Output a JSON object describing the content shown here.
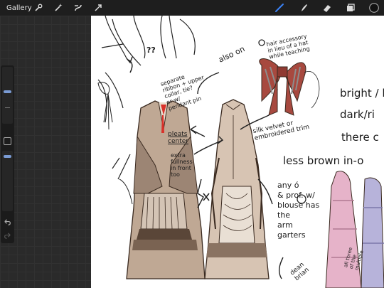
{
  "topbar": {
    "gallery_label": "Gallery",
    "icons": [
      "wrench-icon",
      "magic-wand-icon",
      "selection-icon",
      "transform-icon",
      "brush-icon",
      "smudge-icon",
      "eraser-icon",
      "layers-icon",
      "color-swatch"
    ],
    "active_color": "#111111",
    "accent": "#3b82f6"
  },
  "canvas_notes": {
    "hair_accessory": "hair accessory\nin lieu of a hat\nwhile teaching",
    "also_on": "also on",
    "question_marks": "??",
    "separate_ribbon": "separate\nribbon + upper\ncollar, tie?\nor w/\npendant pin",
    "pleats_center": "pleats\ncenter",
    "extra_fullness": "extra\nfullness\nin front\ntoo",
    "silk_velvet": "silk velvet or\nembroidered trim",
    "bright": "bright / li",
    "dark": "dark/ri",
    "there": "there c",
    "less_brown": "less brown in-o",
    "any_prof": "any ó\n& prof. w/\nblouse has\nthe\narm\ngarters",
    "dean": "dean\nbrian",
    "side_note": "all three\nof the\nmultiple"
  }
}
